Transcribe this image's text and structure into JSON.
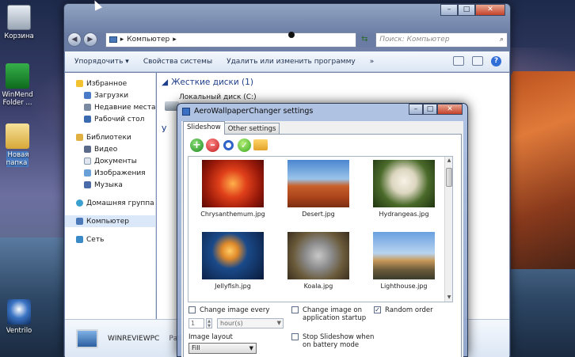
{
  "desktop": {
    "icons": [
      {
        "label": "Корзина",
        "icon": "recycle-bin-icon"
      },
      {
        "label": "WinMend Folder ...",
        "icon": "winmend-icon"
      },
      {
        "label": "Новая папка",
        "icon": "folder-icon"
      },
      {
        "label": "Ventrilo",
        "icon": "ventrilo-icon"
      }
    ]
  },
  "explorer": {
    "address": "Компьютер",
    "search_placeholder": "Поиск: Компьютер",
    "toolbar": {
      "organize": "Упорядочить ▾",
      "system_properties": "Свойства системы",
      "uninstall": "Удалить или изменить программу",
      "more": "»"
    },
    "nav": {
      "favorites": "Избранное",
      "downloads": "Загрузки",
      "recent": "Недавние места",
      "desktop": "Рабочий стол",
      "libraries": "Библиотеки",
      "video": "Видео",
      "documents": "Документы",
      "images": "Изображения",
      "music": "Музыка",
      "homegroup": "Домашняя группа",
      "computer": "Компьютер",
      "network": "Сеть"
    },
    "content": {
      "hard_drives": "Жесткие диски (1)",
      "local_disk": "Локальный диск (C:)",
      "other_section": "У"
    },
    "details": {
      "pc_name": "WINREVIEWPC",
      "pc_workgroup": "Рабо"
    }
  },
  "dialog": {
    "title": "AeroWallpaperChanger settings",
    "tabs": [
      "Slideshow",
      "Other settings"
    ],
    "thumbnails": [
      {
        "name": "Chrysanthemum.jpg"
      },
      {
        "name": "Desert.jpg"
      },
      {
        "name": "Hydrangeas.jpg"
      },
      {
        "name": "Jellyfish.jpg"
      },
      {
        "name": "Koala.jpg"
      },
      {
        "name": "Lighthouse.jpg"
      }
    ],
    "options": {
      "change_every": "Change image every",
      "change_every_checked": false,
      "interval_value": "1",
      "interval_unit": "hour(s)",
      "change_on_startup": "Change image on application startup",
      "change_on_startup_checked": false,
      "random_order": "Random order",
      "random_order_checked": true,
      "image_layout_label": "Image layout",
      "image_layout_value": "Fill",
      "stop_on_battery": "Stop Slideshow when on battery mode",
      "stop_on_battery_checked": false
    }
  }
}
